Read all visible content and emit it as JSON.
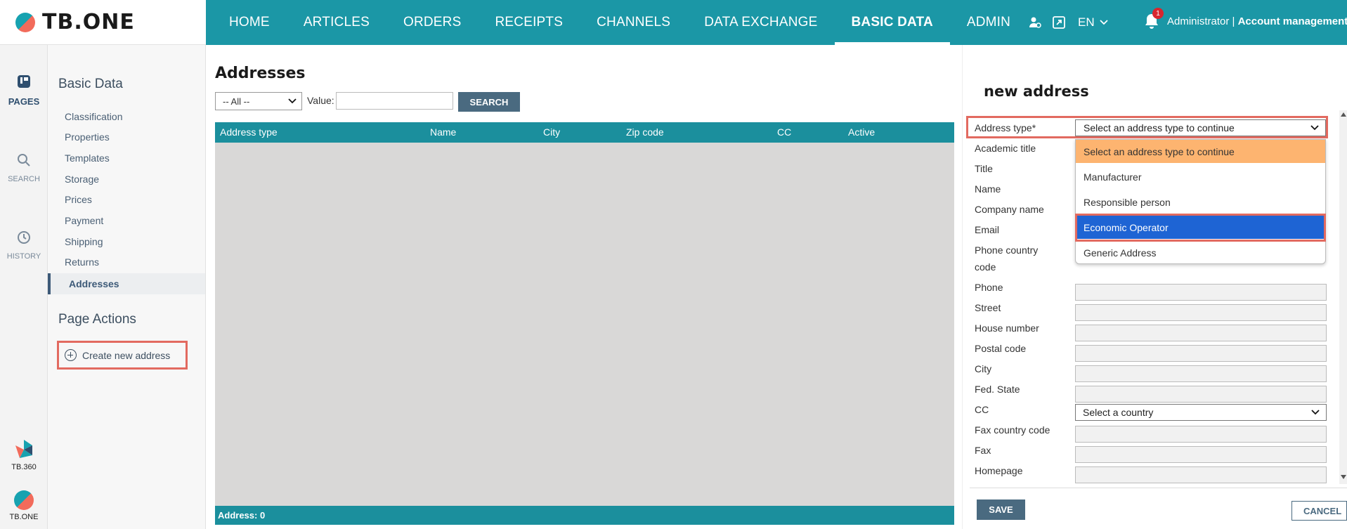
{
  "app": {
    "logo_text": "TB.ONE"
  },
  "nav": {
    "items": [
      "HOME",
      "ARTICLES",
      "ORDERS",
      "RECEIPTS",
      "CHANNELS",
      "DATA EXCHANGE",
      "BASIC DATA",
      "ADMIN"
    ],
    "active": "BASIC DATA"
  },
  "topbar": {
    "language": "EN",
    "notification_count": "1",
    "user_name": "Administrator",
    "separator": " | ",
    "account_link": "Account management"
  },
  "rail": {
    "pages": "PAGES",
    "search": "SEARCH",
    "history": "HISTORY",
    "brand1": "TB.360",
    "brand2": "TB.ONE"
  },
  "sidebar": {
    "title": "Basic Data",
    "items": [
      "Classification",
      "Properties",
      "Templates",
      "Storage",
      "Prices",
      "Payment",
      "Shipping",
      "Returns",
      "Addresses"
    ],
    "active": "Addresses",
    "actions_title": "Page Actions",
    "create_label": "Create new address"
  },
  "list": {
    "title": "Addresses",
    "filter_selected": "-- All --",
    "value_label": "Value:",
    "value_input": "",
    "search_label": "SEARCH",
    "columns": [
      "Address type",
      "Name",
      "City",
      "Zip code",
      "CC",
      "Active"
    ],
    "footer": "Address: 0"
  },
  "form": {
    "title": "new address",
    "address_type_label": "Address type*",
    "address_type_value": "Select an address type to continue",
    "dropdown_options": [
      "Select an address type to continue",
      "Manufacturer",
      "Responsible person",
      "Economic Operator",
      "Generic Address"
    ],
    "dropdown_hover": "Select an address type to continue",
    "dropdown_selected": "Economic Operator",
    "fields": [
      "Academic title",
      "Title",
      "Name",
      "Company name",
      "Email",
      "Phone country code",
      "Phone",
      "Street",
      "House number",
      "Postal code",
      "City",
      "Fed. State",
      "CC",
      "Fax country code",
      "Fax",
      "Homepage"
    ],
    "cc_value": "Select a country",
    "save_label": "SAVE",
    "cancel_label": "CANCEL"
  },
  "colors": {
    "teal": "#1b97a6",
    "highlight_red": "#e26a60",
    "selected_blue": "#1e64d4",
    "hover_orange": "#fdb470"
  }
}
